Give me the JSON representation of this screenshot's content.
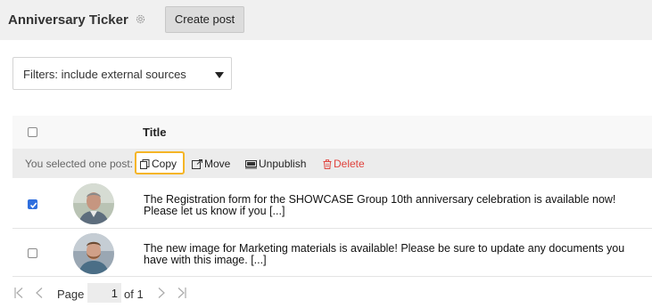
{
  "header": {
    "title": "Anniversary Ticker",
    "settings_icon": "gear-icon",
    "create_label": "Create post"
  },
  "filter": {
    "label": "Filters: include external sources",
    "icon": "caret-down-icon"
  },
  "table": {
    "title_header": "Title",
    "selection": {
      "text": "You selected one post:",
      "actions": [
        {
          "label": "Copy",
          "icon": "copy-icon"
        },
        {
          "label": "Move",
          "icon": "move-icon"
        },
        {
          "label": "Unpublish",
          "icon": "unpublish-icon"
        },
        {
          "label": "Delete",
          "icon": "trash-icon"
        }
      ]
    },
    "rows": [
      {
        "checked": true,
        "text": "The Registration form for the SHOWCASE Group 10th anniversary celebration is available now! Please let us know if you [...]"
      },
      {
        "checked": false,
        "text": "The new image for Marketing materials is available! Please be sure to update any documents you have with this image.  [...]"
      }
    ]
  },
  "pagination": {
    "page_label": "Page",
    "current_page": "1",
    "of_label": "of 1"
  },
  "colors": {
    "accent": "#2f6fde",
    "highlight": "#f5b526",
    "delete": "#e0443e"
  }
}
